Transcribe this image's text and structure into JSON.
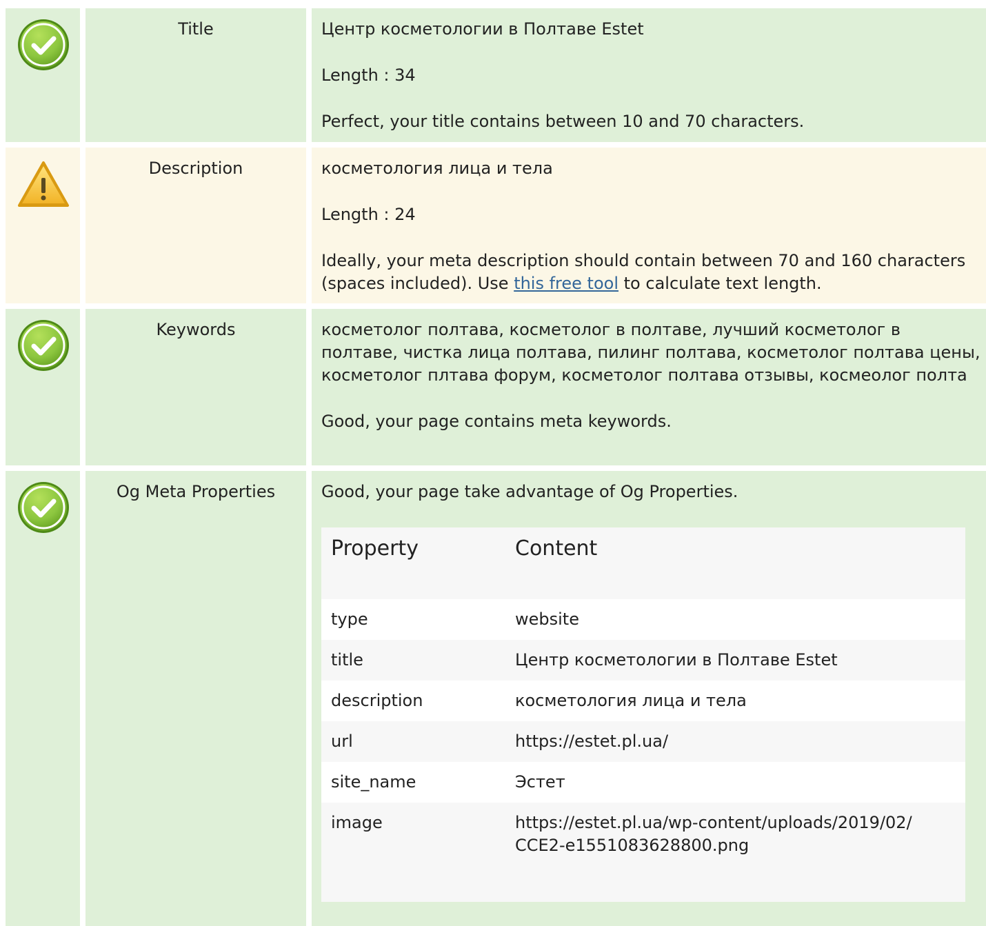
{
  "colors": {
    "good_bg": "#dff0d8",
    "warn_bg": "#fcf7e6",
    "link": "#336699",
    "check_green": "#8cc63f",
    "warn_yellow": "#f5c431"
  },
  "rows": [
    {
      "status": "good",
      "icon": "check-circle-icon",
      "label": "Title",
      "value": "Центр косметологии в Полтаве Estet",
      "length": "Length : 34",
      "message": "Perfect, your title contains between 10 and 70 characters."
    },
    {
      "status": "warning",
      "icon": "warning-triangle-icon",
      "label": "Description",
      "value": "косметология лица и тела",
      "length": "Length : 24",
      "message_before": "Ideally, your meta description should contain between 70 and 160 characters (spaces included). Use ",
      "link_text": "this free tool",
      "message_after": " to calculate text length."
    },
    {
      "status": "good",
      "icon": "check-circle-icon",
      "label": "Keywords",
      "value": "косметолог полтава, косметолог в полтаве, лучший косметолог в полтаве, чистка лица полтава, пилинг полтава, косметолог полтава цены, косметолог плтава форум, косметолог полтава отзывы, космеолог полта",
      "message": "Good, your page contains meta keywords."
    },
    {
      "status": "good",
      "icon": "check-circle-icon",
      "label": "Og Meta Properties",
      "message": "Good, your page take advantage of Og Properties.",
      "table": {
        "headers": [
          "Property",
          "Content"
        ],
        "rows": [
          [
            "type",
            "website"
          ],
          [
            "title",
            "Центр косметологии в Полтаве Estet"
          ],
          [
            "description",
            "косметология лица и тела"
          ],
          [
            "url",
            "https://estet.pl.ua/"
          ],
          [
            "site_name",
            "Эстет"
          ],
          [
            "image",
            "https://estet.pl.ua/wp-content/uploads/2019/02/CCE2-e1551083628800.png"
          ]
        ]
      }
    }
  ]
}
